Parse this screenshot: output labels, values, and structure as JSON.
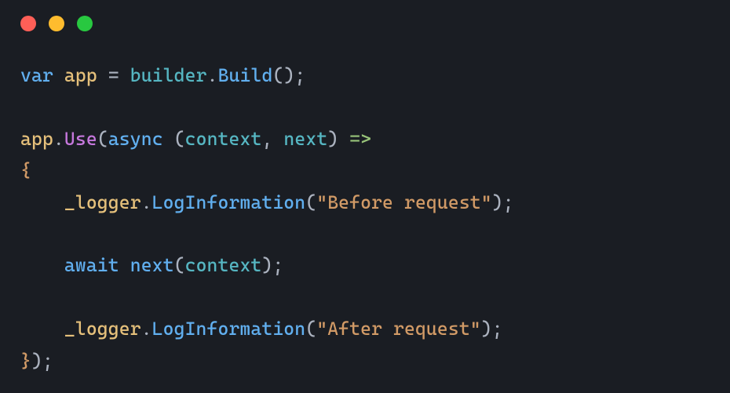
{
  "window": {
    "traffic_light_colors": {
      "close": "#ff5f57",
      "minimize": "#febc2e",
      "maximize": "#28c840"
    }
  },
  "code": {
    "keywords": {
      "var": "var",
      "async": "async",
      "await": "await"
    },
    "identifiers": {
      "app": "app",
      "builder": "builder",
      "logger": "_logger"
    },
    "methods": {
      "Build": "Build",
      "Use": "Use",
      "LogInformation": "LogInformation",
      "next": "next"
    },
    "params": {
      "context": "context",
      "next": "next"
    },
    "strings": {
      "before": "\"Before request\"",
      "after": "\"After request\""
    },
    "punct": {
      "open_paren": "(",
      "close_paren": ")",
      "open_brace": "{",
      "close_brace": "}",
      "semicolon": ";",
      "comma": ",",
      "dot": ".",
      "assign": "=",
      "arrow": "=>"
    }
  }
}
